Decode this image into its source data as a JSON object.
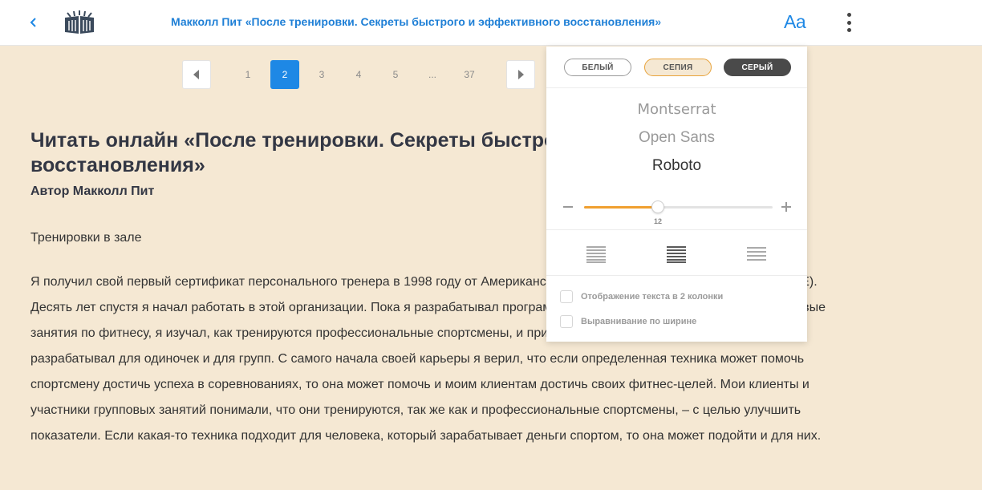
{
  "header": {
    "title": "Макколл Пит «После тренировки. Секреты быстрого и эффективного восстановления»",
    "font_settings_label": "Aa",
    "back_icon": "chevron-left-icon",
    "logo_icon": "books-logo-icon",
    "menu_icon": "more-vertical-icon"
  },
  "pagination": {
    "prev_icon": "caret-left-icon",
    "next_icon": "caret-right-icon",
    "pages": [
      "1",
      "2",
      "3",
      "4",
      "5",
      "...",
      "37"
    ],
    "current": "2"
  },
  "article": {
    "title": "Читать онлайн «После тренировки. Секреты быстрого и эффективного восстановления»",
    "author": "Автор Макколл Пит",
    "subheading": "Тренировки в зале",
    "paragraph": "Я получил свой первый сертификат персонального тренера в 1998 году от Американского совета по физической подготовке (ACE). Десять лет спустя я начал работать в этой организации. Пока я разрабатывал программы тренировок для клиентов и вел групповые занятия по фитнесу, я изучал, как тренируются профессиональные спортсмены, и применял этот опыт в тренировках, которые разрабатывал для одиночек и для групп. С самого начала своей карьеры я верил, что если определенная техника может помочь спортсмену достичь успеха в соревнованиях, то она может помочь и моим клиентам достичь своих фитнес-целей. Мои клиенты и участники групповых занятий понимали, что они тренируются, так же как и профессиональные спортсмены, – с целью улучшить показатели. Если какая-то техника подходит для человека, который зарабатывает деньги спортом, то она может подойти и для них."
  },
  "settings_panel": {
    "themes": [
      {
        "label": "БЕЛЫЙ",
        "selected": false
      },
      {
        "label": "СЕПИЯ",
        "selected": true
      },
      {
        "label": "СЕРЫЙ",
        "selected": false
      }
    ],
    "fonts": [
      "Montserrat",
      "Open Sans",
      "Roboto"
    ],
    "selected_font": "Roboto",
    "font_size": {
      "value": "12",
      "fraction": 0.39,
      "minus_icon": "minus-icon",
      "plus_icon": "plus-icon"
    },
    "alignments": [
      "align-justify-icon",
      "align-justify-bold-icon",
      "align-left-icon"
    ],
    "selected_alignment": 1,
    "options": [
      {
        "label": "Отображение текста в 2 колонки",
        "checked": false
      },
      {
        "label": "Выравнивание по ширине",
        "checked": false
      }
    ]
  },
  "colors": {
    "accent": "#1e88e5",
    "sepia_background": "#f5e8d3",
    "slider_fill": "#f0a030",
    "gray_theme": "#4a4a4a"
  }
}
